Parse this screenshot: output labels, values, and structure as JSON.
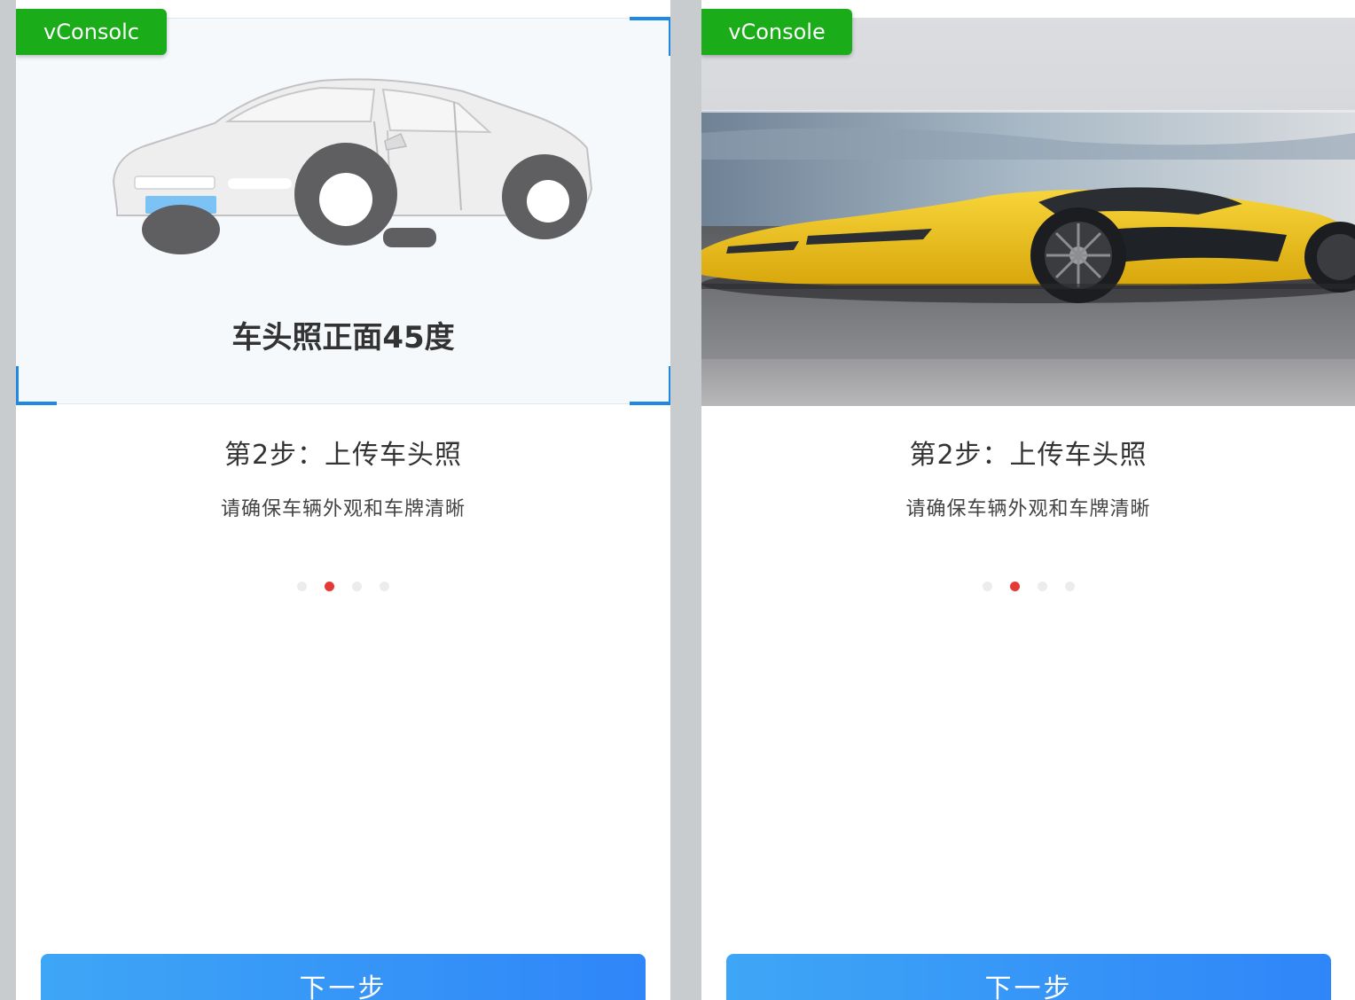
{
  "left_screen": {
    "vconsole_label": "vConsolc",
    "guide_caption": "车头照正面45度",
    "step_title": "第2步：上传车头照",
    "step_desc": "请确保车辆外观和车牌清晰",
    "next_label": "下一步",
    "dots": {
      "count": 4,
      "active_index": 1
    }
  },
  "right_screen": {
    "vconsole_label": "vConsole",
    "step_title": "第2步：上传车头照",
    "step_desc": "请确保车辆外观和车牌清晰",
    "next_label": "下一步",
    "dots": {
      "count": 4,
      "active_index": 1
    }
  },
  "colors": {
    "vconsole_green": "#1aad19",
    "corner_blue": "#1e88e5",
    "dot_active": "#e53935",
    "button_blue": "#2f86f8"
  }
}
